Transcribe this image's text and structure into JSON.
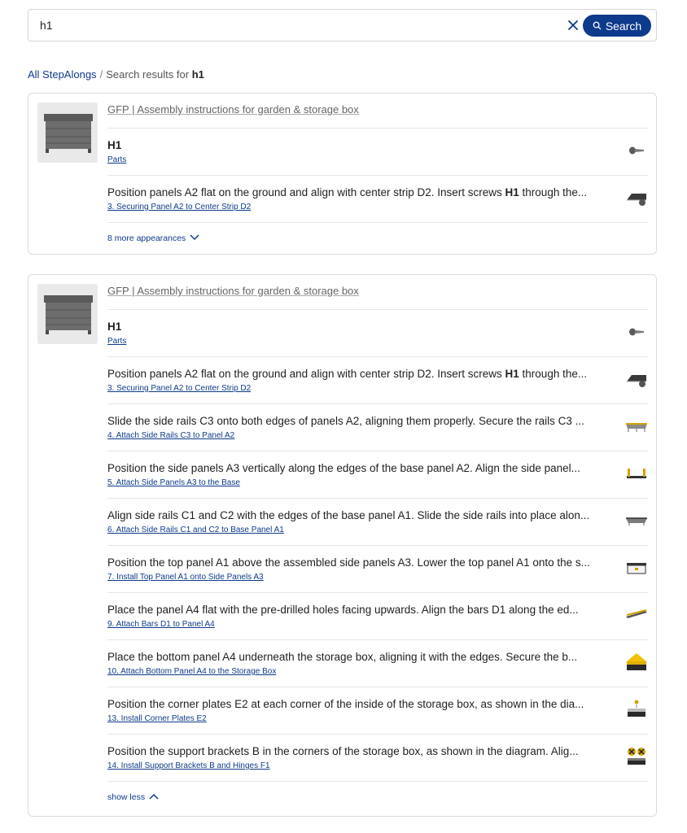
{
  "search": {
    "value": "h1",
    "button_label": "Search"
  },
  "breadcrumb": {
    "root": "All StepAlongs",
    "separator": "/",
    "prefix": "Search results for ",
    "query": "h1"
  },
  "cards": [
    {
      "title": "GFP | Assembly instructions for garden & storage box",
      "part": {
        "name": "H1",
        "link": "Parts"
      },
      "results": [
        {
          "pre": "Position panels A2 flat on the ground and align with center strip D2. Insert screws ",
          "hl": "H1",
          "post": " through the...",
          "link": "3. Securing Panel A2 to Center Strip D2"
        }
      ],
      "toggle": "8 more appearances"
    },
    {
      "title": "GFP | Assembly instructions for garden & storage box",
      "part": {
        "name": "H1",
        "link": "Parts"
      },
      "results": [
        {
          "pre": "Position panels A2 flat on the ground and align with center strip D2. Insert screws ",
          "hl": "H1",
          "post": " through the...",
          "link": "3. Securing Panel A2 to Center Strip D2"
        },
        {
          "pre": "Slide the side rails C3 onto both edges of panels A2, aligning them properly. Secure the rails C3 ...",
          "hl": "",
          "post": "",
          "link": "4. Attach Side Rails C3 to Panel A2"
        },
        {
          "pre": "Position the side panels A3 vertically along the edges of the base panel A2. Align the side panel...",
          "hl": "",
          "post": "",
          "link": "5. Attach Side Panels A3 to the Base"
        },
        {
          "pre": "Align side rails C1 and C2 with the edges of the base panel A1. Slide the side rails into place alon...",
          "hl": "",
          "post": "",
          "link": "6. Attach Side Rails C1 and C2 to Base Panel A1"
        },
        {
          "pre": "Position the top panel A1 above the assembled side panels A3. Lower the top panel A1 onto the s...",
          "hl": "",
          "post": "",
          "link": "7. Install Top Panel A1 onto Side Panels A3"
        },
        {
          "pre": "Place the panel A4 flat with the pre-drilled holes facing upwards. Align the bars D1 along the ed...",
          "hl": "",
          "post": "",
          "link": "9. Attach Bars D1 to Panel A4"
        },
        {
          "pre": "Place the bottom panel A4 underneath the storage box, aligning it with the edges. Secure the b...",
          "hl": "",
          "post": "",
          "link": "10. Attach Bottom Panel A4 to the Storage Box"
        },
        {
          "pre": "Position the corner plates E2 at each corner of the inside of the storage box, as shown in the dia...",
          "hl": "",
          "post": "",
          "link": "13. Install Corner Plates E2"
        },
        {
          "pre": "Position the support brackets B in the corners of the storage box, as shown in the diagram. Alig...",
          "hl": "",
          "post": "",
          "link": "14. Install Support Brackets B and Hinges F1"
        }
      ],
      "toggle": "show less"
    }
  ],
  "colors": {
    "accent": "#0e3a8c",
    "border": "#dcdcdc",
    "muted_text": "#666666"
  }
}
